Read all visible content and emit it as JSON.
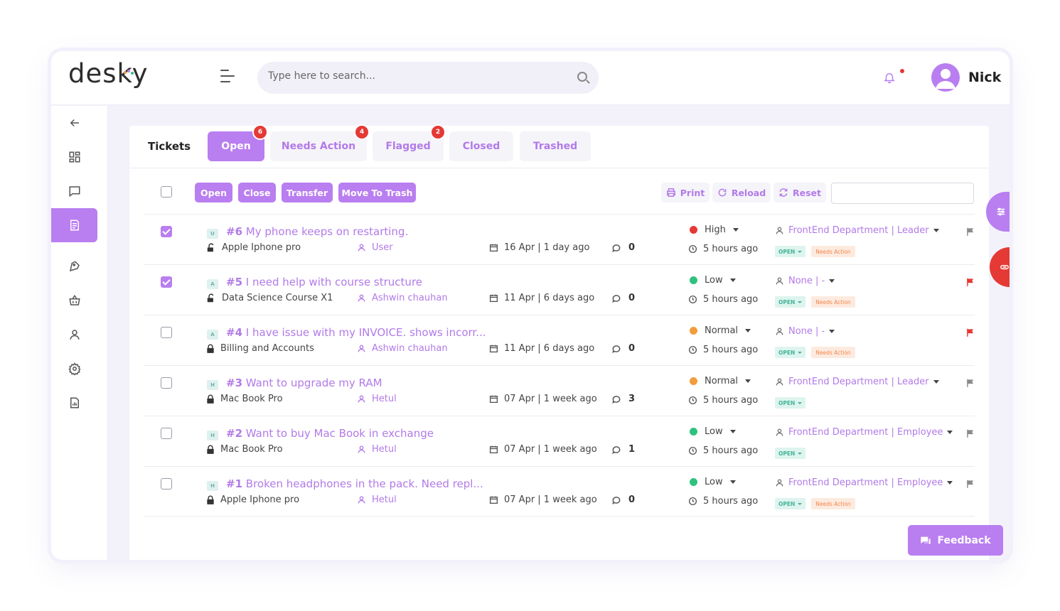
{
  "header": {
    "logo_text": "desky",
    "search_placeholder": "Type here to search...",
    "user_name": "Nick"
  },
  "colors": {
    "accent": "#b97ef0",
    "accent_text": "#b27ae8",
    "danger": "#e53935"
  },
  "sidebar": {
    "items": [
      {
        "icon": "arrow-left-icon"
      },
      {
        "icon": "dashboard-icon"
      },
      {
        "icon": "chat-icon"
      },
      {
        "icon": "tickets-icon",
        "active": true
      },
      {
        "icon": "tag-icon"
      },
      {
        "icon": "basket-icon"
      },
      {
        "icon": "user-icon"
      },
      {
        "icon": "settings-icon"
      },
      {
        "icon": "report-icon"
      }
    ]
  },
  "tabs": {
    "title": "Tickets",
    "items": [
      {
        "label": "Open",
        "badge": "6",
        "active": true
      },
      {
        "label": "Needs Action",
        "badge": "4"
      },
      {
        "label": "Flagged",
        "badge": "2"
      },
      {
        "label": "Closed",
        "badge": ""
      },
      {
        "label": "Trashed",
        "badge": ""
      }
    ]
  },
  "toolbar": {
    "actions": [
      "Open",
      "Close",
      "Transfer",
      "Move To Trash"
    ],
    "utilities": [
      "Print",
      "Reload",
      "Reset"
    ],
    "filter_value": ""
  },
  "tickets": [
    {
      "letter": "U",
      "id": "#6",
      "title": "My phone keeps on restarting.",
      "product": "Apple Iphone pro",
      "lock": "open",
      "user": "User",
      "date": "16 Apr | 1 day ago",
      "comments": "0",
      "priority": "High",
      "priority_color": "#e53935",
      "age": "5 hours ago",
      "dept": "FrontEnd Department | Leader",
      "status": "OPEN",
      "needs_action": "Needs Action",
      "flag_color": "#8a8a8a",
      "checked": true
    },
    {
      "letter": "A",
      "id": "#5",
      "title": "I need help with course structure",
      "product": "Data Science Course X1",
      "lock": "open",
      "user": "Ashwin chauhan",
      "date": "11 Apr | 6 days ago",
      "comments": "0",
      "priority": "Low",
      "priority_color": "#2ec27e",
      "age": "5 hours ago",
      "dept": "None | -",
      "status": "OPEN",
      "needs_action": "Needs Action",
      "flag_color": "#e53935",
      "checked": true
    },
    {
      "letter": "A",
      "id": "#4",
      "title": "I have issue with my INVOICE. shows incorr...",
      "product": "Billing and Accounts",
      "lock": "closed",
      "user": "Ashwin chauhan",
      "date": "11 Apr | 6 days ago",
      "comments": "0",
      "priority": "Normal",
      "priority_color": "#f39c3c",
      "age": "5 hours ago",
      "dept": "None | -",
      "status": "OPEN",
      "needs_action": "Needs Action",
      "flag_color": "#e53935",
      "checked": false
    },
    {
      "letter": "H",
      "id": "#3",
      "title": "Want to upgrade my RAM",
      "product": "Mac Book Pro",
      "lock": "closed",
      "user": "Hetul",
      "date": "07 Apr | 1 week ago",
      "comments": "3",
      "priority": "Normal",
      "priority_color": "#f39c3c",
      "age": "5 hours ago",
      "dept": "FrontEnd Department | Leader",
      "status": "OPEN",
      "needs_action": "",
      "flag_color": "#8a8a8a",
      "checked": false
    },
    {
      "letter": "H",
      "id": "#2",
      "title": "Want to buy Mac Book in exchange",
      "product": "Mac Book Pro",
      "lock": "closed",
      "user": "Hetul",
      "date": "07 Apr | 1 week ago",
      "comments": "1",
      "priority": "Low",
      "priority_color": "#2ec27e",
      "age": "5 hours ago",
      "dept": "FrontEnd Department | Employee",
      "status": "OPEN",
      "needs_action": "",
      "flag_color": "#8a8a8a",
      "checked": false
    },
    {
      "letter": "H",
      "id": "#1",
      "title": "Broken headphones in the pack. Need repl...",
      "product": "Apple Iphone pro",
      "lock": "closed",
      "user": "Hetul",
      "date": "07 Apr | 1 week ago",
      "comments": "0",
      "priority": "Low",
      "priority_color": "#2ec27e",
      "age": "5 hours ago",
      "dept": "FrontEnd Department | Employee",
      "status": "OPEN",
      "needs_action": "Needs Action",
      "flag_color": "#8a8a8a",
      "checked": false
    }
  ],
  "feedback_label": "Feedback"
}
